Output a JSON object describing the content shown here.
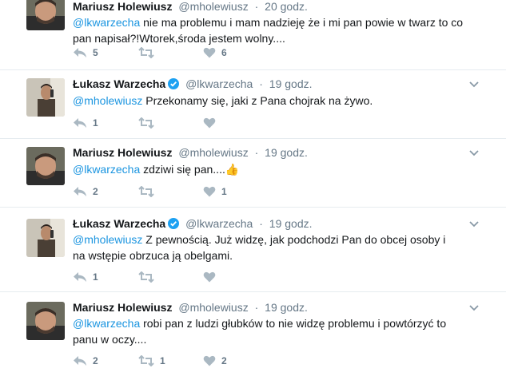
{
  "tweets": [
    {
      "name": "Mariusz Holewiusz",
      "handle": "@mholewiusz",
      "time": "20 godz.",
      "mention": "@lkwarzecha",
      "text": " nie ma problemu i mam nadzieję że i mi pan powie w twarz to co pan napisał?!Wtorek,środa jestem wolny....",
      "replies": "5",
      "retweets": "",
      "likes": "6",
      "verified": false
    },
    {
      "name": "Łukasz Warzecha",
      "handle": "@lkwarzecha",
      "time": "19 godz.",
      "mention": "@mholewiusz",
      "text": " Przekonamy się, jaki z Pana chojrak na żywo.",
      "replies": "1",
      "retweets": "",
      "likes": "",
      "verified": true
    },
    {
      "name": "Mariusz Holewiusz",
      "handle": "@mholewiusz",
      "time": "19 godz.",
      "mention": "@lkwarzecha",
      "text": " zdziwi się pan....",
      "emoji": "👍",
      "replies": "2",
      "retweets": "",
      "likes": "1",
      "verified": false
    },
    {
      "name": "Łukasz Warzecha",
      "handle": "@lkwarzecha",
      "time": "19 godz.",
      "mention": "@mholewiusz",
      "text": " Z pewnością. Już widzę, jak podchodzi Pan do obcej osoby i na wstępie obrzuca ją obelgami.",
      "replies": "1",
      "retweets": "",
      "likes": "",
      "verified": true
    },
    {
      "name": "Mariusz Holewiusz",
      "handle": "@mholewiusz",
      "time": "19 godz.",
      "mention": "@lkwarzecha",
      "text": " robi pan z ludzi głubków to nie widzę problemu i powtórzyć to panu w oczy....",
      "replies": "2",
      "retweets": "1",
      "likes": "2",
      "verified": false
    }
  ],
  "colors": {
    "mention": "#1b95e0",
    "verified": "#1da1f2",
    "muted": "#657786",
    "divider": "#e6ecf0"
  },
  "icons": [
    "reply-icon",
    "retweet-icon",
    "like-icon",
    "verified-icon",
    "caret-down-icon",
    "thumbs-up-emoji"
  ]
}
